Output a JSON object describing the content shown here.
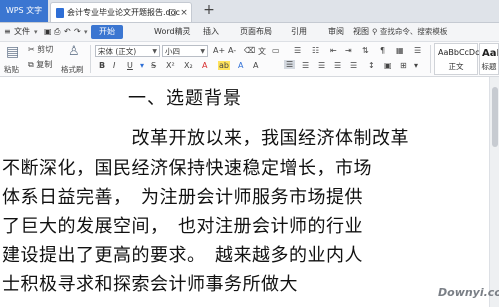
{
  "tabbar": {
    "app_label": "WPS 文字",
    "doc_title": "会计专业毕业论文开题报告.doc",
    "close_glyph": "×",
    "new_tab_glyph": "+"
  },
  "menu": {
    "file": "文件",
    "start": "开始",
    "items": [
      "Word精灵",
      "插入",
      "页面布局",
      "引用",
      "审阅",
      "视图"
    ],
    "search": "查找命令、搜索模板"
  },
  "ribbon": {
    "paste": "粘贴",
    "cut": "剪切",
    "copy": "复制",
    "format_painter": "格式刷",
    "font_name": "宋体 (正文)",
    "font_size": "小四",
    "grow": "A+",
    "shrink": "A-",
    "bold": "B",
    "italic": "I",
    "underline": "U",
    "style_normal_sample": "AaBbCcDc",
    "style_normal_name": "正文",
    "style_heading_sample": "AaI",
    "style_heading_name": "标题"
  },
  "document": {
    "heading": "一、选题背景",
    "lines": [
      "　　　　　　　改革开放以来，我国经济体制改革",
      "不断深化，国民经济保持快速稳定增长，市场",
      "体系日益完善，　为注册会计师服务市场提供",
      "了巨大的发展空间，　也对注册会计师的行业",
      "建设提出了更高的要求。　越来越多的业内人",
      "士积极寻求和探索会计师事务所做大"
    ]
  },
  "watermark": "Downyi.com",
  "colors": {
    "accent": "#3b76d1",
    "tab_bg": "#dfe3e9"
  }
}
